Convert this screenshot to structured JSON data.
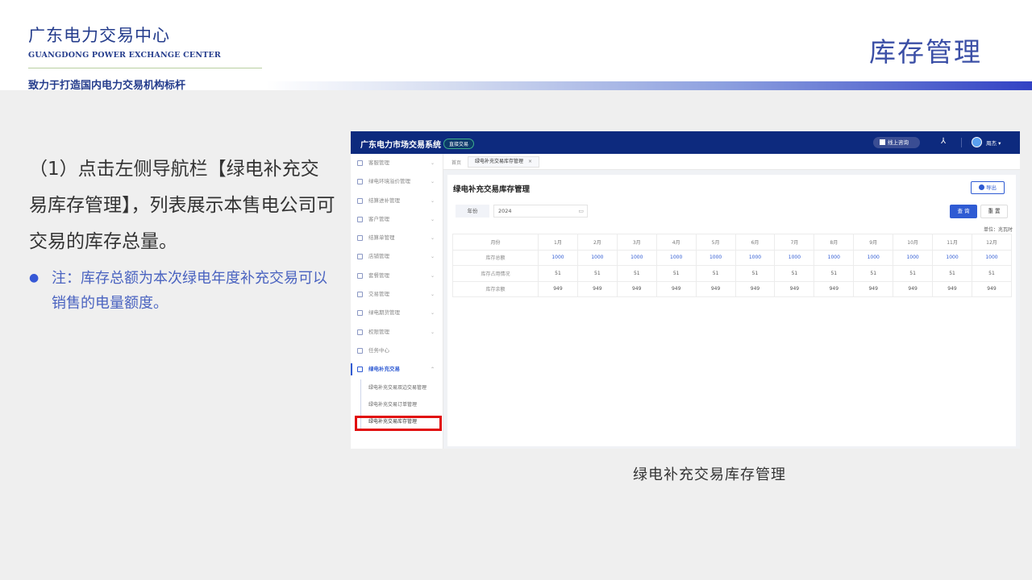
{
  "header": {
    "org_cn": "广东电力交易中心",
    "org_en": "GUANGDONG POWER EXCHANGE CENTER",
    "slogan": "致力于打造国内电力交易机构标杆",
    "title": "库存管理"
  },
  "intro": {
    "step": "（1）点击左侧导航栏【绿电补充交易库存管理】，列表展示本售电公司可交易的库存总量。",
    "note": "注：库存总额为本次绿电年度补充交易可以销售的电量额度。"
  },
  "app": {
    "name": "广东电力市场交易系统",
    "badge": "直接交易",
    "consult_label": "线上咨询",
    "user": "周杰",
    "sidebar": {
      "items": [
        {
          "label": "客服管理"
        },
        {
          "label": "绿电环境溢价管理"
        },
        {
          "label": "结算进补管理"
        },
        {
          "label": "客户管理"
        },
        {
          "label": "结算单管理"
        },
        {
          "label": "店铺管理"
        },
        {
          "label": "套餐管理"
        },
        {
          "label": "交易管理"
        },
        {
          "label": "绿电期货管理"
        },
        {
          "label": "权限管理"
        },
        {
          "label": "任务中心"
        },
        {
          "label": "绿电补充交易"
        }
      ],
      "sub_items": [
        {
          "label": "绿电补充交易双边交易管理"
        },
        {
          "label": "绿电补充交易订单管理"
        },
        {
          "label": "绿电补充交易库存管理"
        }
      ],
      "collapse_glyph": "☰"
    },
    "tabs": {
      "home": "首页",
      "active": "绿电补充交易库存管理"
    },
    "panel": {
      "title": "绿电补充交易库存管理",
      "export_label": "导出",
      "filter_label": "年份",
      "filter_value": "2024",
      "query_label": "查 询",
      "reset_label": "重 置",
      "unit": "单位：兆瓦时",
      "table": {
        "headers": [
          "月份",
          "1月",
          "2月",
          "3月",
          "4月",
          "5月",
          "6月",
          "7月",
          "8月",
          "9月",
          "10月",
          "11月",
          "12月"
        ],
        "rows": [
          {
            "label": "库存总额",
            "values": [
              "1000",
              "1000",
              "1000",
              "1000",
              "1000",
              "1000",
              "1000",
              "1000",
              "1000",
              "1000",
              "1000",
              "1000"
            ]
          },
          {
            "label": "库存占用情况",
            "values": [
              "51",
              "51",
              "51",
              "51",
              "51",
              "51",
              "51",
              "51",
              "51",
              "51",
              "51",
              "51"
            ]
          },
          {
            "label": "库存余额",
            "values": [
              "949",
              "949",
              "949",
              "949",
              "949",
              "949",
              "949",
              "949",
              "949",
              "949",
              "949",
              "949"
            ]
          }
        ]
      }
    }
  },
  "caption": "绿电补充交易库存管理",
  "colors": {
    "brand_navy": "#0d2a7e",
    "accent_blue": "#2f5bd3",
    "highlight_red": "#e10d0d",
    "title_blue": "#3b4fa6"
  }
}
